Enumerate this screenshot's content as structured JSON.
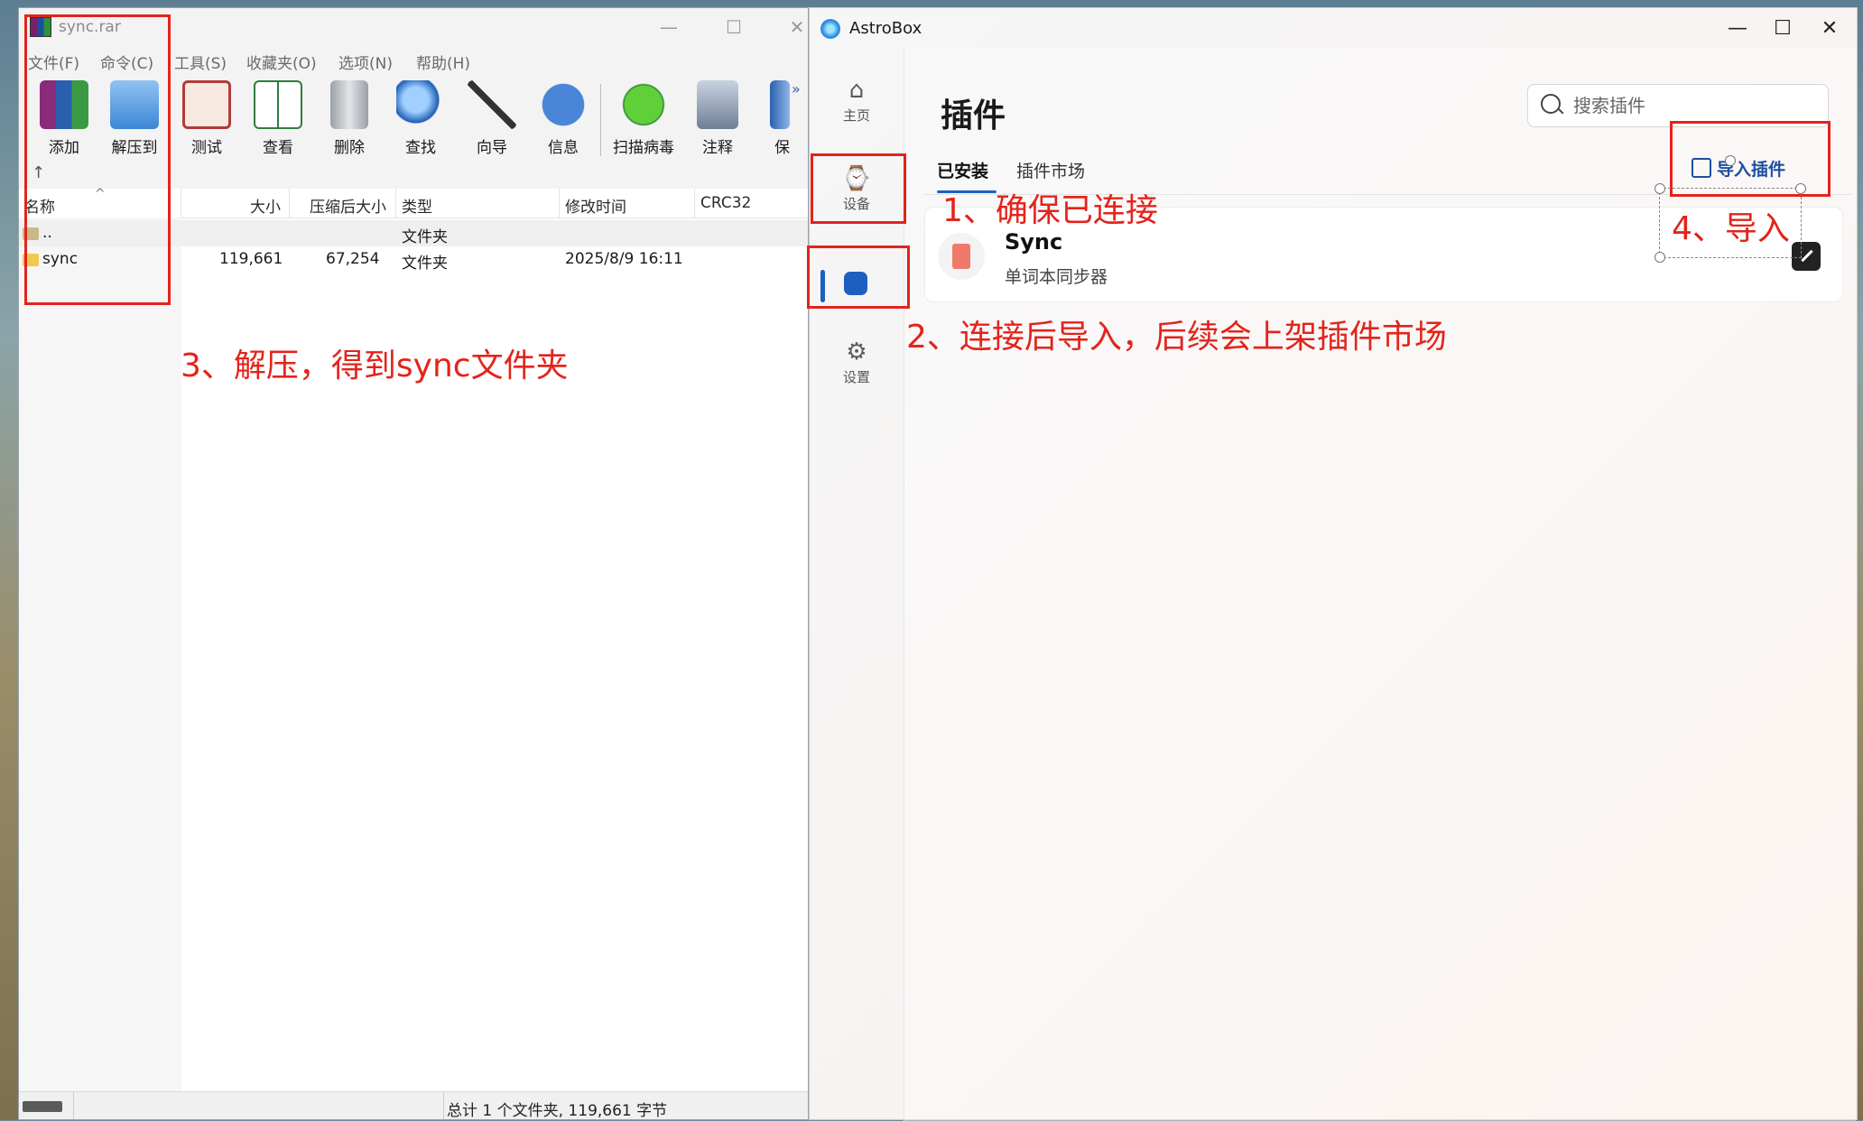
{
  "winrar": {
    "title": "sync.rar",
    "controls": {
      "minimize": "—",
      "maximize": "☐",
      "close": "✕"
    },
    "menu": [
      "文件(F)",
      "命令(C)",
      "工具(S)",
      "收藏夹(O)",
      "选项(N)",
      "帮助(H)"
    ],
    "toolbar": [
      "添加",
      "解压到",
      "测试",
      "查看",
      "删除",
      "查找",
      "向导",
      "信息",
      "扫描病毒",
      "注释",
      "保"
    ],
    "columns": [
      "名称",
      "大小",
      "压缩后大小",
      "类型",
      "修改时间",
      "CRC32"
    ],
    "rows": [
      {
        "name": "..",
        "size": "",
        "packed": "",
        "type": "文件夹",
        "modified": "",
        "crc": ""
      },
      {
        "name": "sync",
        "size": "119,661",
        "packed": "67,254",
        "type": "文件夹",
        "modified": "2025/8/9 16:11",
        "crc": ""
      }
    ],
    "status": "总计 1 个文件夹, 119,661 字节"
  },
  "astrobox": {
    "title": "AstroBox",
    "controls": {
      "minimize": "—",
      "maximize": "☐",
      "close": "✕"
    },
    "sidebar": [
      "主页",
      "设备",
      "设置"
    ],
    "heading": "插件",
    "search_placeholder": "搜索插件",
    "tabs": [
      "已安装",
      "插件市场"
    ],
    "import_label": "导入插件",
    "plugin": {
      "name": "Sync",
      "desc": "单词本同步器"
    }
  },
  "annotations": {
    "step1": "1、确保已连接",
    "step2": "2、连接后导入，后续会上架插件市场",
    "step3": "3、解压，得到sync文件夹",
    "step4": "4、导入"
  },
  "colors": {
    "annotation": "#e4231b",
    "accent": "#1d5fbf"
  }
}
